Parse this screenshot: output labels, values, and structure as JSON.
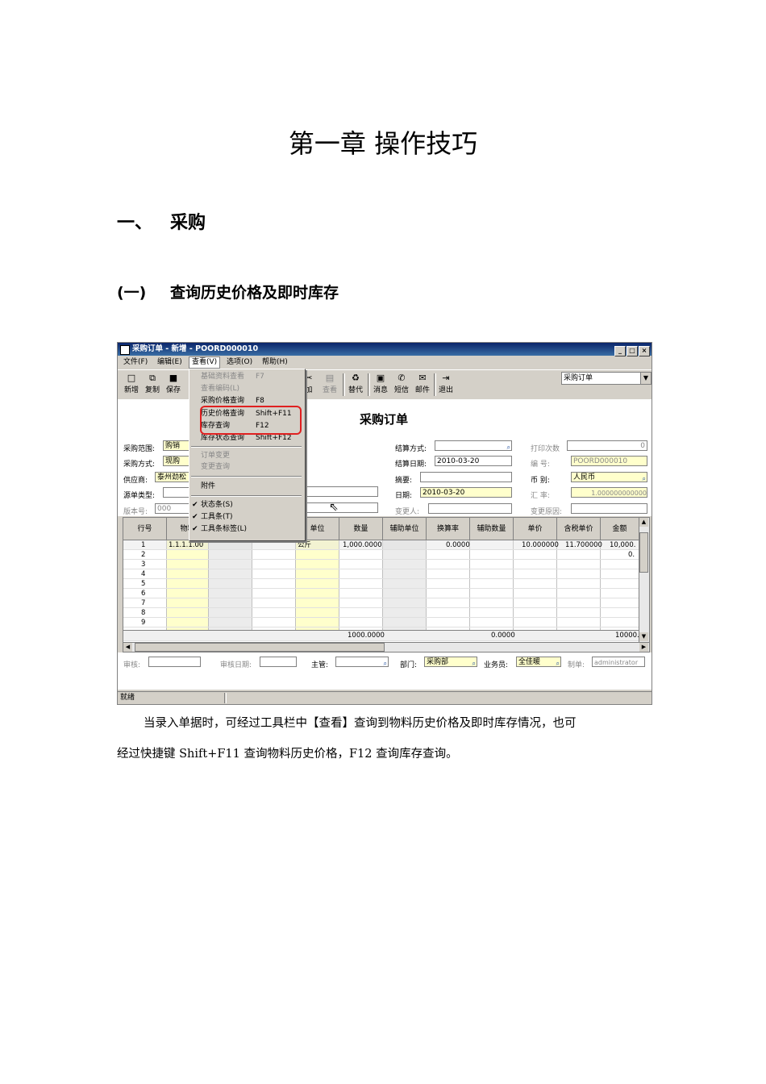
{
  "doc": {
    "chapter_title": "第一章  操作技巧",
    "section": {
      "num": "一、",
      "title": "采购"
    },
    "subsection": {
      "num": "(一)",
      "title": "查询历史价格及即时库存"
    },
    "paragraph_line1": "当录入单据时，可经过工具栏中【查看】查询到物料历史价格及即时库存情况，也可",
    "paragraph_line2": "经过快捷键 Shift+F11 查询物料历史价格，F12 查询库存查询。"
  },
  "window": {
    "title": "采购订单 - 新增 - POORD000010",
    "buttons": {
      "min": "_",
      "max": "□",
      "close": "×"
    }
  },
  "menubar": [
    "文件(F)",
    "编辑(E)",
    "查看(V)",
    "选项(O)",
    "帮助(H)"
  ],
  "toolbar": {
    "new": "新增",
    "copy": "复制",
    "save": "保存",
    "add": "加",
    "view": "查看",
    "replace": "替代",
    "message": "消息",
    "sms": "短信",
    "mail": "邮件",
    "exit": "退出",
    "combo_value": "采购订单"
  },
  "view_menu": {
    "items": [
      {
        "label": "基础资料查看",
        "shortcut": "F7"
      },
      {
        "label": "查看编码(L)",
        "shortcut": ""
      },
      {
        "label": "采购价格查询",
        "shortcut": "F8"
      },
      {
        "label": "历史价格查询",
        "shortcut": "Shift+F11"
      },
      {
        "label": "库存查询",
        "shortcut": "F12"
      },
      {
        "label": "库存状态查询",
        "shortcut": "Shift+F12"
      },
      {
        "label": "订单变更",
        "shortcut": ""
      },
      {
        "label": "变更查询",
        "shortcut": ""
      },
      {
        "label": "附件",
        "shortcut": ""
      },
      {
        "label": "状态条(S)",
        "shortcut": ""
      },
      {
        "label": "工具条(T)",
        "shortcut": ""
      },
      {
        "label": "工具条标签(L)",
        "shortcut": ""
      }
    ]
  },
  "form": {
    "title": "采购订单",
    "purchase_scope_label": "采购范围:",
    "purchase_scope": "购销",
    "purchase_mode_label": "采购方式:",
    "purchase_mode": "现购",
    "supplier_label": "供应商:",
    "supplier": "泰州劲松",
    "source_type_label": "源单类型:",
    "version_label": "版本号:",
    "version": "000",
    "settle_mode_label": "结算方式:",
    "settle_date_label": "结算日期:",
    "settle_date": "2010-03-20",
    "summary_label": "摘要:",
    "date_label": "日期:",
    "date": "2010-03-20",
    "changer_label": "变更人:",
    "print_count_label": "打印次数",
    "print_count": "0",
    "number_label": "编    号:",
    "number": "POORD000010",
    "currency_label": "币    别:",
    "currency": "人民币",
    "rate_label": "汇    率:",
    "rate": "1.000000000000",
    "change_reason_label": "变更原因:"
  },
  "grid": {
    "headers": [
      "行号",
      "物料",
      "",
      "",
      "单位",
      "数量",
      "辅助单位",
      "换算率",
      "辅助数量",
      "单价",
      "含税单价",
      "金额"
    ],
    "row1": {
      "no": "1",
      "material": "1.1.1.1.00",
      "unit": "公斤",
      "qty": "1,000.0000",
      "rate": "0.0000",
      "price": "10.000000",
      "tax_price": "11.700000",
      "amount": "10,000."
    },
    "row2_amount": "0.",
    "row_numbers": [
      "1",
      "2",
      "3",
      "4",
      "5",
      "6",
      "7",
      "8",
      "9"
    ],
    "total_qty": "1000.0000",
    "total_aux": "0.0000",
    "total_amount": "10000."
  },
  "footer": {
    "audit_label": "审核:",
    "audit_date_label": "审核日期:",
    "manager_label": "主管:",
    "dept_label": "部门:",
    "dept": "采购部",
    "salesman_label": "业务员:",
    "salesman": "全佳暖",
    "maker_label": "制单:",
    "maker": "administrator"
  },
  "status": "就绪"
}
